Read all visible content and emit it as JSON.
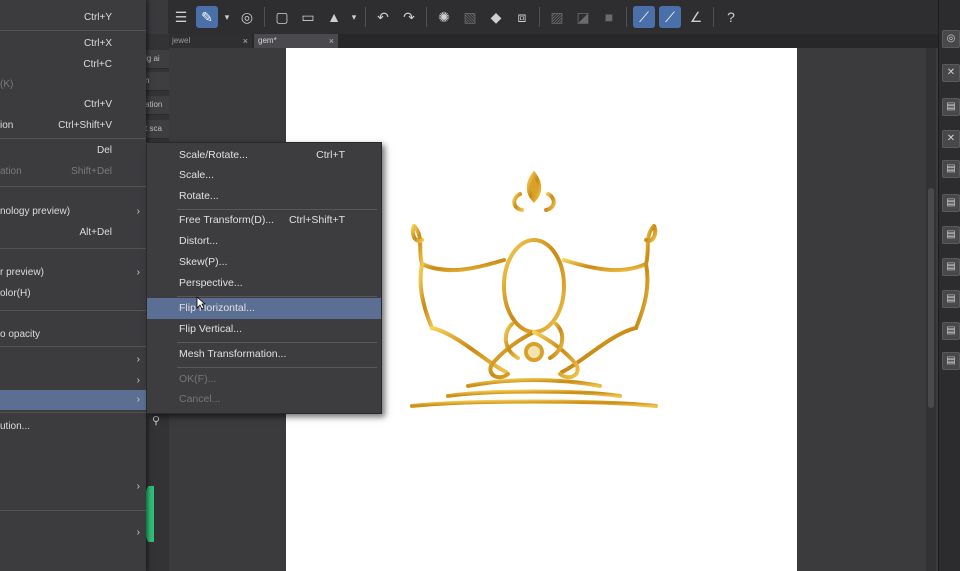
{
  "main_menu": {
    "items": [
      {
        "label": "",
        "shortcut": "Ctrl+Y",
        "arrow": false,
        "disabled": false
      },
      {
        "label": "",
        "shortcut": "Ctrl+X",
        "arrow": false,
        "disabled": false
      },
      {
        "label": "",
        "shortcut": "Ctrl+C",
        "arrow": false,
        "disabled": false
      },
      {
        "label": "(K)",
        "shortcut": "",
        "arrow": false,
        "disabled": true
      },
      {
        "label": "",
        "shortcut": "Ctrl+V",
        "arrow": false,
        "disabled": false
      },
      {
        "label": "ion",
        "shortcut": "Ctrl+Shift+V",
        "arrow": false,
        "disabled": false
      },
      {
        "label": "",
        "shortcut": "Del",
        "arrow": false,
        "disabled": false
      },
      {
        "label": "ation",
        "shortcut": "Shift+Del",
        "arrow": false,
        "disabled": true
      },
      {
        "label": "nology preview)",
        "shortcut": "",
        "arrow": true,
        "disabled": false
      },
      {
        "label": "",
        "shortcut": "Alt+Del",
        "arrow": false,
        "disabled": false
      },
      {
        "label": "r preview)",
        "shortcut": "",
        "arrow": true,
        "disabled": false
      },
      {
        "label": "olor(H)",
        "shortcut": "",
        "arrow": false,
        "disabled": false
      },
      {
        "label": "o opacity",
        "shortcut": "",
        "arrow": false,
        "disabled": false
      },
      {
        "label": "",
        "shortcut": "",
        "arrow": true,
        "disabled": false
      },
      {
        "label": "",
        "shortcut": "",
        "arrow": true,
        "disabled": false
      },
      {
        "label": "",
        "shortcut": "",
        "arrow": true,
        "disabled": false
      },
      {
        "label": "ution...",
        "shortcut": "",
        "arrow": false,
        "disabled": false
      },
      {
        "label": "",
        "shortcut": "",
        "arrow": true,
        "disabled": false
      },
      {
        "label": "",
        "shortcut": "",
        "arrow": true,
        "disabled": false
      }
    ]
  },
  "transform_menu": {
    "items": [
      {
        "label": "Scale/Rotate...",
        "shortcut": "Ctrl+T",
        "disabled": false
      },
      {
        "label": "Scale...",
        "shortcut": "",
        "disabled": false
      },
      {
        "label": "Rotate...",
        "shortcut": "",
        "disabled": false
      },
      {
        "label": "Free Transform(D)...",
        "shortcut": "Ctrl+Shift+T",
        "disabled": false
      },
      {
        "label": "Distort...",
        "shortcut": "",
        "disabled": false
      },
      {
        "label": "Skew(P)...",
        "shortcut": "",
        "disabled": false
      },
      {
        "label": "Perspective...",
        "shortcut": "",
        "disabled": false
      },
      {
        "label": "Flip Horizontal...",
        "shortcut": "",
        "disabled": false
      },
      {
        "label": "Flip Vertical...",
        "shortcut": "",
        "disabled": false
      },
      {
        "label": "Mesh Transformation...",
        "shortcut": "",
        "disabled": false
      },
      {
        "label": "OK(F)...",
        "shortcut": "",
        "disabled": true
      },
      {
        "label": "Cancel...",
        "shortcut": "",
        "disabled": true
      }
    ]
  },
  "tabs": [
    {
      "label": "jewel"
    },
    {
      "label": "gem*"
    }
  ],
  "side_buttons": [
    "ig ai",
    "n",
    "ation",
    "t sca"
  ],
  "colors": {
    "menu_bg": "#3c3c3f",
    "highlight": "#5c6f93",
    "toolbar_active": "#4b6fa8",
    "canvas": "#ffffff",
    "gold": "#d9a12a"
  }
}
